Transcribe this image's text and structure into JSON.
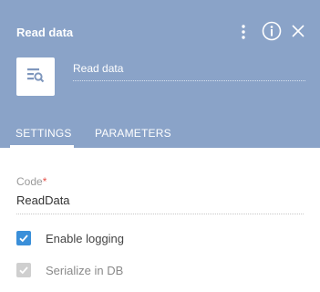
{
  "panel": {
    "title": "Read data",
    "element_name": "Read data"
  },
  "icons": {
    "menu": "kebab-menu-icon",
    "info": "info-icon",
    "close": "close-icon",
    "element": "read-data-icon"
  },
  "tabs": [
    {
      "label": "SETTINGS",
      "active": true
    },
    {
      "label": "PARAMETERS",
      "active": false
    }
  ],
  "fields": {
    "code": {
      "label": "Code",
      "required_mark": "*",
      "value": "ReadData"
    }
  },
  "options": {
    "enable_logging": {
      "label": "Enable logging",
      "checked": true,
      "disabled": false
    },
    "serialize_in_db": {
      "label": "Serialize in DB",
      "checked": true,
      "disabled": true
    }
  },
  "colors": {
    "header_bg": "#8aa3c8",
    "checkbox_active": "#3a8fd9",
    "checkbox_disabled": "#cfcfcf",
    "required": "#e5514a"
  }
}
